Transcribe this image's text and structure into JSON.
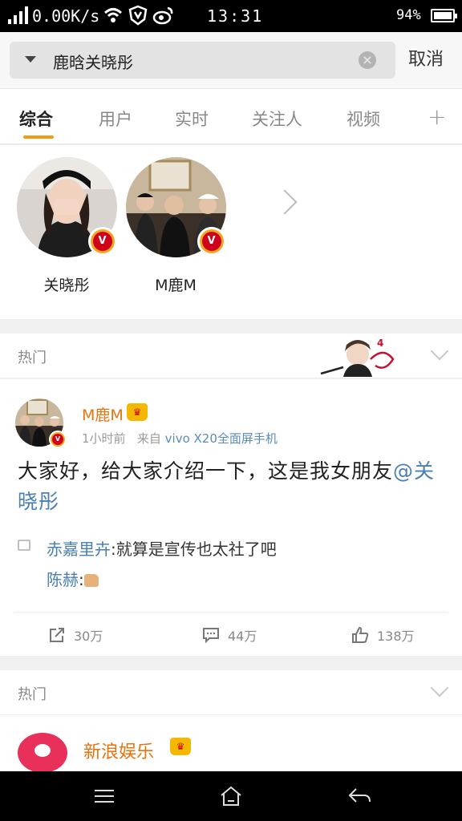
{
  "status_bar": {
    "net_speed": "0.00K/s",
    "time": "13:31",
    "battery": "94%",
    "battery_level": 0.94,
    "icons": [
      "signal-icon",
      "wifi-icon",
      "shield-icon",
      "weibo-icon"
    ]
  },
  "search": {
    "query": "鹿晗关晓彤",
    "cancel_label": "取消"
  },
  "tabs": [
    {
      "label": "综合"
    },
    {
      "label": "用户"
    },
    {
      "label": "实时"
    },
    {
      "label": "关注人"
    },
    {
      "label": "视频"
    }
  ],
  "users": [
    {
      "name": "关晓彤"
    },
    {
      "name": "M鹿M"
    }
  ],
  "sections": {
    "hot_label_1": "热门",
    "hot_label_2": "热门"
  },
  "post": {
    "author": "M鹿M",
    "time": "1小时前",
    "from_prefix": "来自",
    "source": "vivo X20全面屏手机",
    "text_plain": "大家好，给大家介绍一下，这是我女朋友",
    "mention": "@关晓彤",
    "comments": [
      {
        "user": "赤嘉里卉",
        "text": ":就算是宣传也太社了吧"
      },
      {
        "user": "陈赫",
        "text": ":"
      }
    ],
    "reposts": "30万",
    "comments_count": "44万",
    "likes": "138万"
  },
  "card2": {
    "author": "新浪娱乐"
  },
  "colors": {
    "accent": "#f39c12",
    "author_orange": "#e8730c",
    "link_blue": "#4a7fb5"
  }
}
